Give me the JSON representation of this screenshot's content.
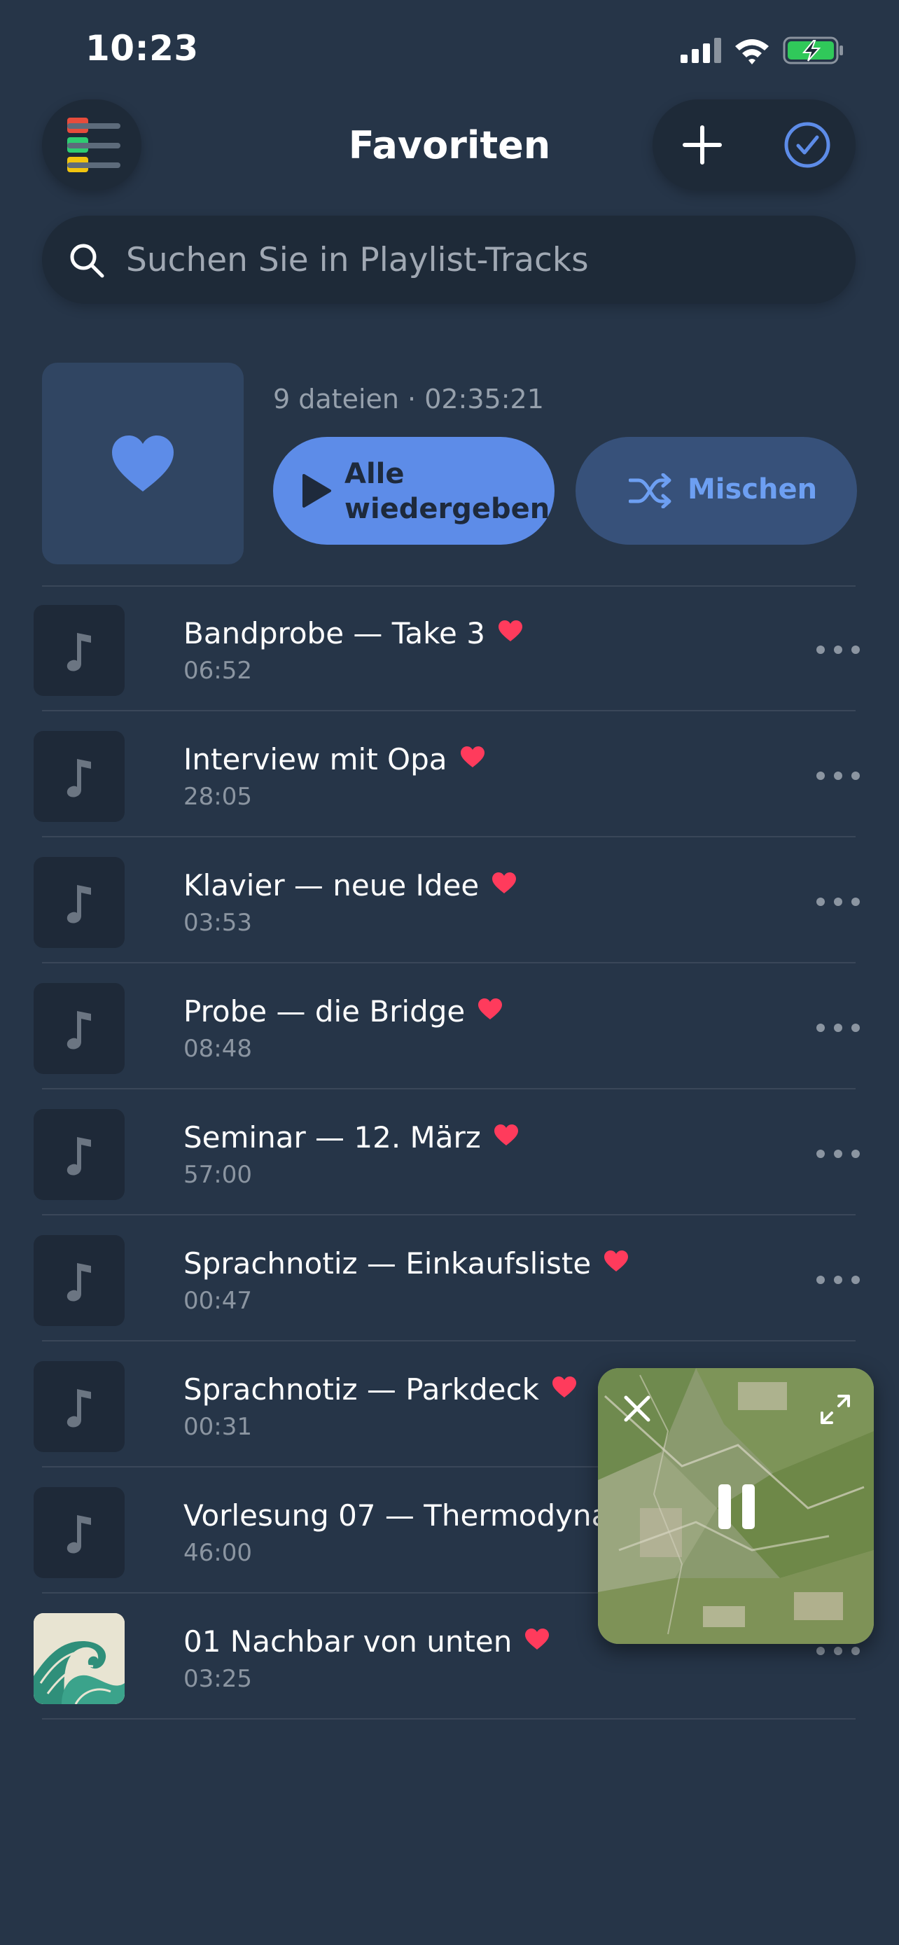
{
  "status_bar": {
    "time": "10:23"
  },
  "header": {
    "title": "Favoriten"
  },
  "search": {
    "placeholder": "Suchen Sie in Playlist-Tracks"
  },
  "playlist": {
    "meta": "9 dateien · 02:35:21",
    "play_all_line1": "Alle",
    "play_all_line2": "wiedergeben",
    "shuffle_label": "Mischen"
  },
  "tracks": [
    {
      "title": "Bandprobe — Take 3",
      "duration": "06:52"
    },
    {
      "title": "Interview mit Opa",
      "duration": "28:05"
    },
    {
      "title": "Klavier — neue Idee",
      "duration": "03:53"
    },
    {
      "title": "Probe — die Bridge",
      "duration": "08:48"
    },
    {
      "title": "Seminar — 12. März",
      "duration": "57:00"
    },
    {
      "title": "Sprachnotiz — Einkaufsliste",
      "duration": "00:47"
    },
    {
      "title": "Sprachnotiz — Parkdeck",
      "duration": "00:31"
    },
    {
      "title": "Vorlesung 07 — Thermodyna",
      "duration": "46:00"
    },
    {
      "title": "01 Nachbar von unten",
      "duration": "03:25"
    }
  ],
  "colors": {
    "background": "#263548",
    "accent": "#5d8ce8",
    "heart": "#ff3b5c"
  }
}
